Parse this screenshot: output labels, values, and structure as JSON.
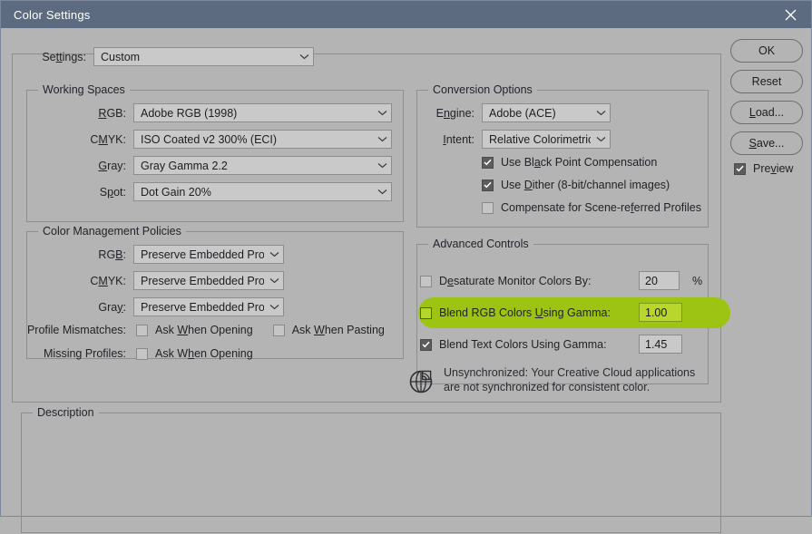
{
  "window": {
    "title": "Color Settings",
    "close_icon": "close-icon",
    "titlebar_color": "#5c6b80",
    "dialog_background": "#b4b4b4"
  },
  "settings_row": {
    "label_pre": "Se",
    "label_mnemonic": "tt",
    "label_post": "ings:",
    "value": "Custom"
  },
  "working_spaces": {
    "title": "Working Spaces",
    "rows": [
      {
        "label_pre": "",
        "label_mnemonic": "R",
        "label_post": "GB:",
        "value": "Adobe RGB (1998)"
      },
      {
        "label_pre": "C",
        "label_mnemonic": "M",
        "label_post": "YK:",
        "value": "ISO Coated v2 300% (ECI)"
      },
      {
        "label_pre": "",
        "label_mnemonic": "G",
        "label_post": "ray:",
        "value": "Gray Gamma 2.2"
      },
      {
        "label_pre": "S",
        "label_mnemonic": "p",
        "label_post": "ot:",
        "value": "Dot Gain 20%"
      }
    ]
  },
  "color_management_policies": {
    "title": "Color Management Policies",
    "rows": [
      {
        "label_pre": "RG",
        "label_mnemonic": "B",
        "label_post": ":",
        "value": "Preserve Embedded Profiles"
      },
      {
        "label_pre": "C",
        "label_mnemonic": "M",
        "label_post": "YK:",
        "value": "Preserve Embedded Profiles"
      },
      {
        "label_pre": "Gra",
        "label_mnemonic": "y",
        "label_post": ":",
        "value": "Preserve Embedded Profiles"
      }
    ],
    "profile_mismatches": {
      "label": "Profile Mismatches:",
      "ask_opening": {
        "pre": "Ask ",
        "mnemonic": "W",
        "post": "hen Opening",
        "checked": false
      },
      "ask_pasting": {
        "pre": "Ask ",
        "mnemonic": "W",
        "post": "hen Pasting",
        "checked": false
      }
    },
    "missing_profiles": {
      "label": "Missing Profiles:",
      "ask_opening": {
        "pre": "Ask W",
        "mnemonic": "h",
        "post": "en Opening",
        "checked": false
      }
    }
  },
  "conversion_options": {
    "title": "Conversion Options",
    "engine": {
      "label_pre": "E",
      "label_mnemonic": "n",
      "label_post": "gine:",
      "value": "Adobe (ACE)"
    },
    "intent": {
      "label_pre": "",
      "label_mnemonic": "I",
      "label_post": "ntent:",
      "value": "Relative Colorimetric"
    },
    "checkboxes": [
      {
        "pre": "Use Bl",
        "mnemonic": "a",
        "post": "ck Point Compensation",
        "checked": true
      },
      {
        "pre": "Use ",
        "mnemonic": "D",
        "post": "ither (8-bit/channel images)",
        "checked": true
      },
      {
        "pre": "Compensate for Scene-re",
        "mnemonic": "f",
        "post": "erred Profiles",
        "checked": false
      }
    ]
  },
  "advanced_controls": {
    "title": "Advanced Controls",
    "highlight_color": "#9ec413",
    "rows": [
      {
        "pre": "D",
        "mnemonic": "e",
        "post": "saturate Monitor Colors By:",
        "checked": false,
        "value": "20",
        "unit": "%",
        "highlighted": false
      },
      {
        "pre": "Blend RGB Colors ",
        "mnemonic": "U",
        "post": "sing Gamma:",
        "checked": false,
        "value": "1.00",
        "unit": "",
        "highlighted": true
      },
      {
        "pre": "Blend Text Colors Using Gamma:",
        "mnemonic": "",
        "post": "",
        "checked": true,
        "value": "1.45",
        "unit": "",
        "highlighted": false
      }
    ],
    "sync_notice": {
      "icon": "color-sync-icon",
      "text": "Unsynchronized: Your Creative Cloud applications\nare not synchronized for consistent color."
    }
  },
  "description": {
    "title": "Description",
    "body": ""
  },
  "buttons": {
    "ok": "OK",
    "reset": "Reset",
    "load_pre": "",
    "load_mnemonic": "L",
    "load_post": "oad...",
    "save_pre": "",
    "save_mnemonic": "S",
    "save_post": "ave...",
    "preview": {
      "pre": "Pre",
      "mnemonic": "v",
      "post": "iew",
      "checked": true
    }
  }
}
